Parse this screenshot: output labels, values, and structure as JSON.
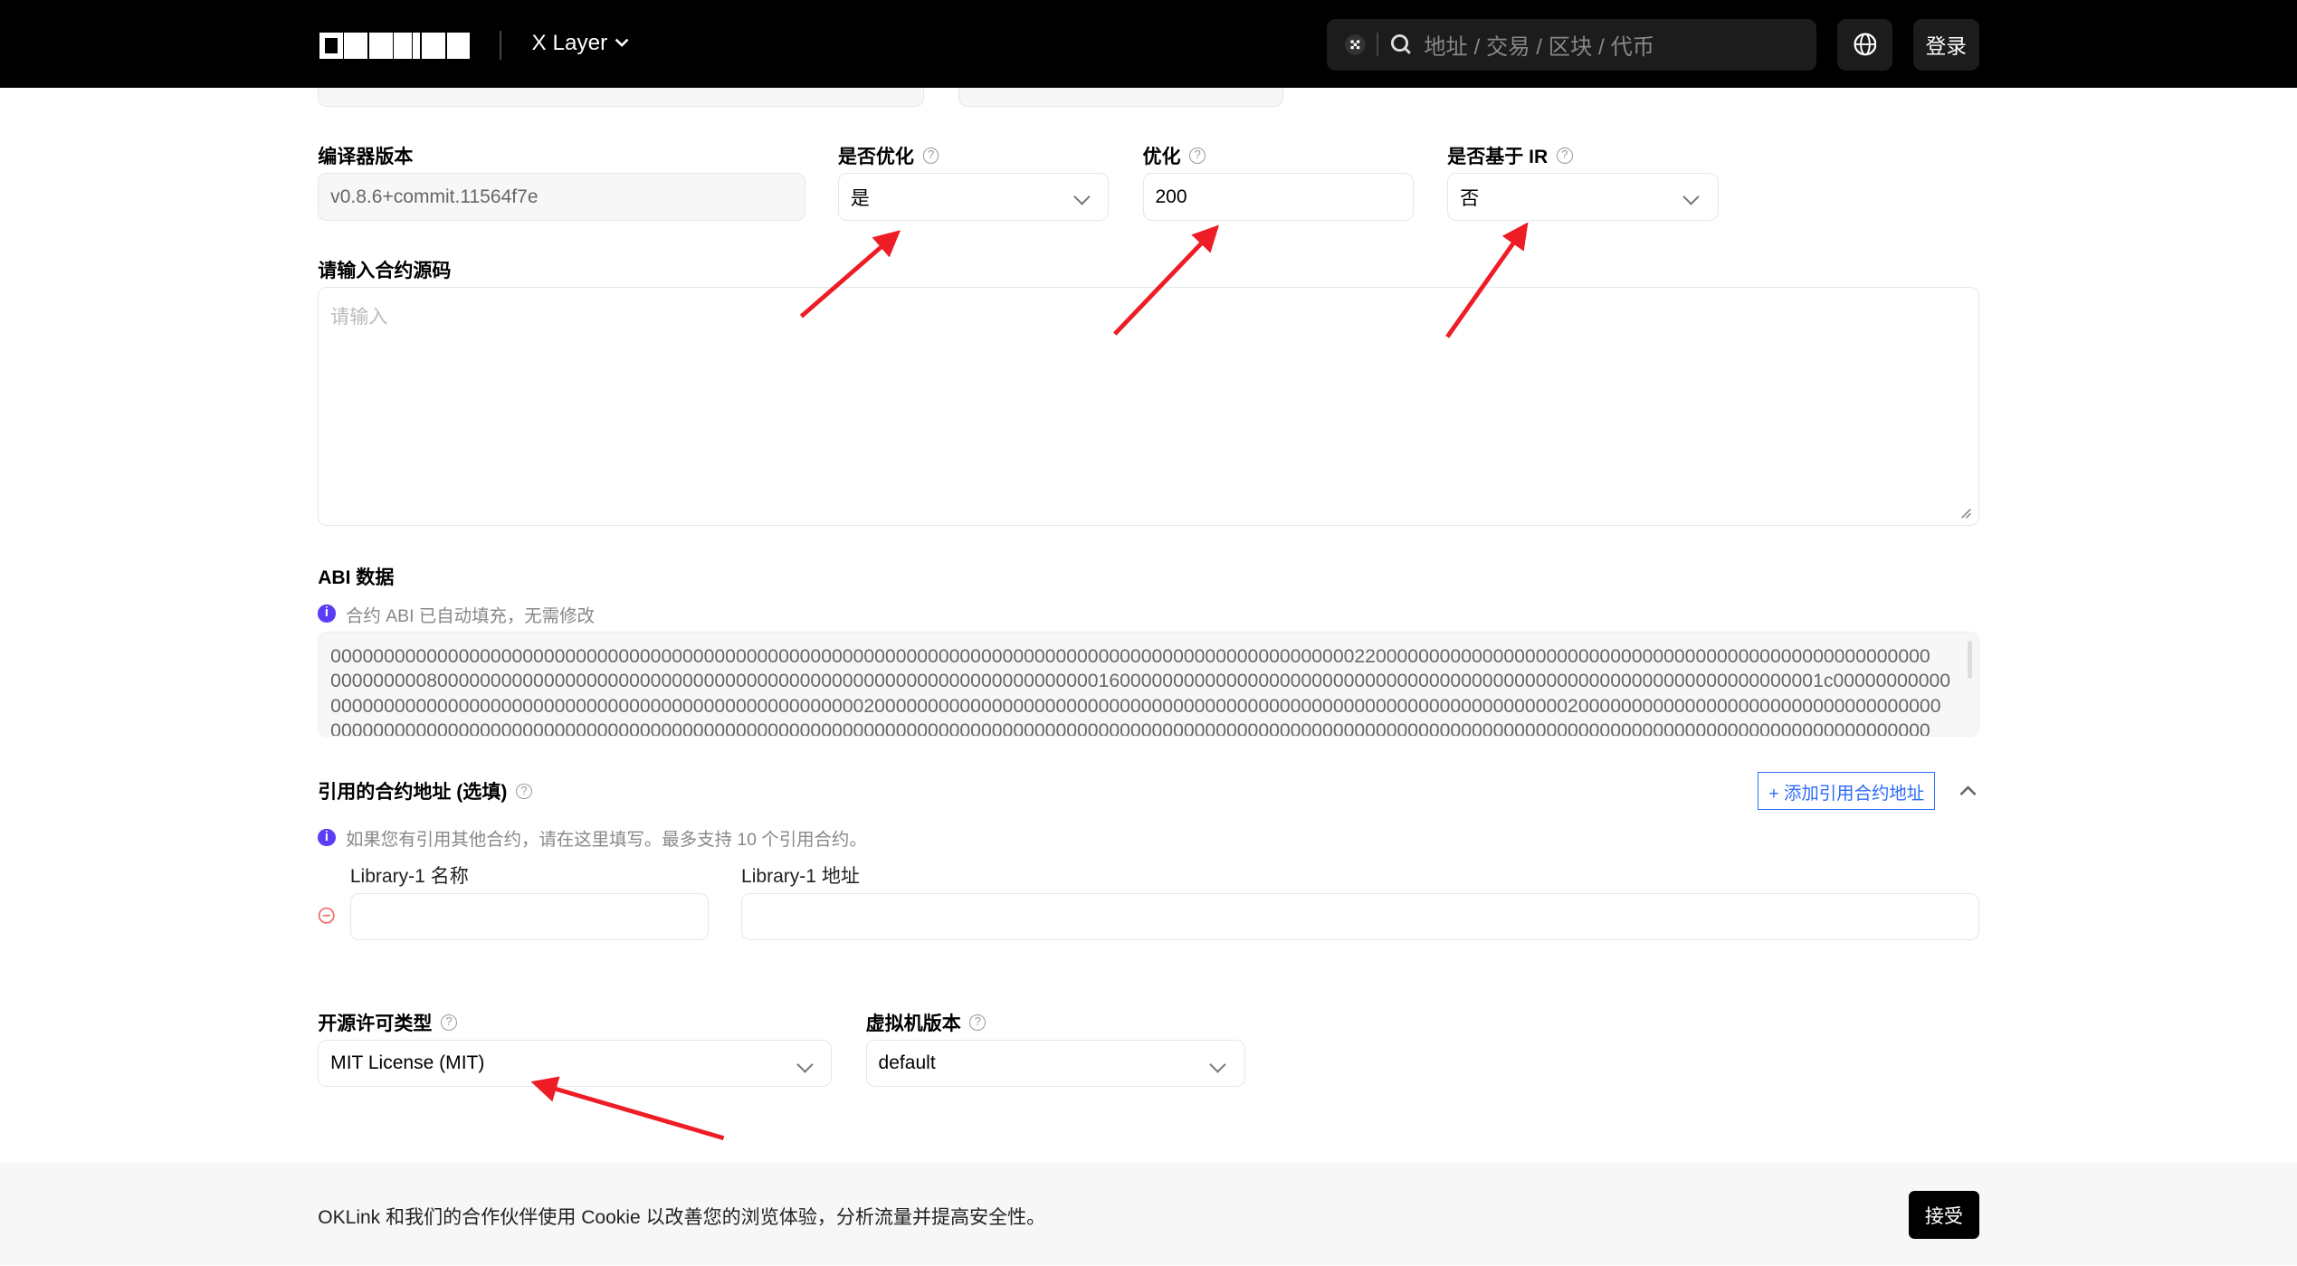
{
  "header": {
    "logo": "OKLINK",
    "chain_selector": "X Layer",
    "search_placeholder": "地址 / 交易 / 区块 / 代币",
    "login_label": "登录"
  },
  "form": {
    "compiler_version": {
      "label": "编译器版本",
      "value": "v0.8.6+commit.11564f7e"
    },
    "optimization_enabled": {
      "label": "是否优化",
      "value": "是"
    },
    "optimization_runs": {
      "label": "优化",
      "value": "200"
    },
    "via_ir": {
      "label": "是否基于 IR",
      "value": "否"
    },
    "source_code": {
      "label": "请输入合约源码",
      "placeholder": "请输入"
    },
    "abi": {
      "label": "ABI 数据",
      "info": "合约 ABI 已自动填充，无需修改",
      "lines": [
        "000000000000000000000000000000000000000000000000000000000000000000000000000000000000000000000000220000000000000000000000000000000000000000000000000000",
        "00000000080000000000000000000000000000000000000000000000000000000000000016000000000000000000000000000000000000000000000000000000000000000001c00000000000",
        "0000000000000000000000000000000000000000000000000020000000000000000000000000000000000000000000000000000000000000000020000000000000000000000000000000000",
        "000000000000000000000000000000000000000000000000000000000000000000000000000000000000000000000000000000000000000000000000000000000000000000000000000000"
      ]
    },
    "libraries": {
      "label": "引用的合约地址 (选填)",
      "add_button": "+ 添加引用合约地址",
      "info": "如果您有引用其他合约，请在这里填写。最多支持 10 个引用合约。",
      "name_label": "Library-1 名称",
      "address_label": "Library-1 地址",
      "name_value": "",
      "address_value": ""
    },
    "license": {
      "label": "开源许可类型",
      "value": "MIT License (MIT)"
    },
    "evm_version": {
      "label": "虚拟机版本",
      "value": "default"
    }
  },
  "cookie": {
    "text": "OKLink 和我们的合作伙伴使用 Cookie 以改善您的浏览体验，分析流量并提高安全性。",
    "accept_label": "接受"
  },
  "colors": {
    "accent": "#2d6cf6",
    "annotation_arrow": "#ee1c25",
    "info_icon": "#5b3df5"
  }
}
